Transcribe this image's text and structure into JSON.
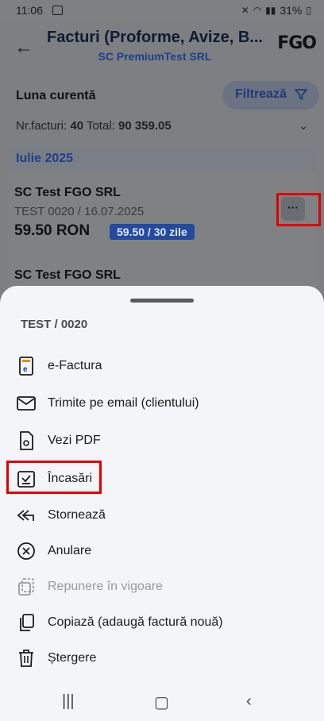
{
  "status_bar": {
    "time": "11:06",
    "battery": "31%"
  },
  "header": {
    "title": "Facturi (Proforme, Avize, B...",
    "subtitle": "SC PremiumTest SRL",
    "logo": "FGO"
  },
  "list": {
    "period": "Luna curentă",
    "filter_label": "Filtrează",
    "summary": {
      "count_label": "Nr.facturi:",
      "count": "40",
      "total_label": "Total:",
      "total": "90 359.05"
    },
    "month": "Iulie 2025",
    "invoices": [
      {
        "client": "SC Test FGO SRL",
        "ref": "TEST 0020 / 16.07.2025",
        "amount": "59.50 RON",
        "badge": "59.50 / 30 zile",
        "more": "···"
      },
      {
        "client": "SC Test FGO SRL"
      }
    ]
  },
  "sheet": {
    "title": "TEST / 0020",
    "items": [
      {
        "label": "e-Factura",
        "icon": "e-invoice-icon"
      },
      {
        "label": "Trimite pe email (clientului)",
        "icon": "email-icon"
      },
      {
        "label": "Vezi PDF",
        "icon": "pdf-icon"
      },
      {
        "label": "Încasări",
        "icon": "payments-icon"
      },
      {
        "label": "Stornează",
        "icon": "reverse-icon"
      },
      {
        "label": "Anulare",
        "icon": "cancel-icon"
      },
      {
        "label": "Repunere în vigoare",
        "icon": "restore-icon",
        "disabled": true
      },
      {
        "label": "Copiază (adaugă factură nouă)",
        "icon": "copy-icon"
      },
      {
        "label": "Ștergere",
        "icon": "trash-icon"
      }
    ]
  },
  "colors": {
    "accent": "#1e3f8c",
    "badge": "#244a9e",
    "highlight": "#e00000"
  }
}
